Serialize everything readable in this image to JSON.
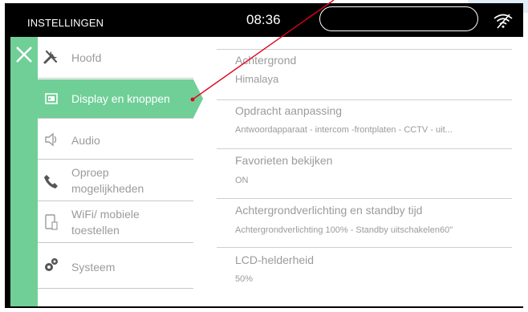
{
  "header": {
    "title": "INSTELLINGEN",
    "time": "08:36"
  },
  "menu": {
    "items": [
      {
        "label": "Hoofd",
        "icon": "wrench-icon"
      },
      {
        "label": "Display en knoppen",
        "icon": "display-icon",
        "active": true
      },
      {
        "label": "Audio",
        "icon": "speaker-icon"
      },
      {
        "label": "Oproep mogelijkheden",
        "icon": "phone-icon"
      },
      {
        "label": "WiFi/ mobiele toestellen",
        "icon": "mobile-device-icon"
      },
      {
        "label": "Systeem",
        "icon": "gears-icon"
      }
    ]
  },
  "settings": [
    {
      "title": "Achtergrond",
      "value": "Himalaya"
    },
    {
      "title": "Opdracht aanpassing",
      "value": "Antwoordapparaat - intercom -frontplaten - CCTV - uit..."
    },
    {
      "title": "Favorieten bekijken",
      "value": "ON"
    },
    {
      "title": "Achtergrondverlichting en standby tijd",
      "value": "Achtergrondverlichting 100% - Standby uitschakelen60\""
    },
    {
      "title": "LCD-helderheid",
      "value": "50%"
    }
  ],
  "colors": {
    "accent_green": "#6fcf97",
    "frame": "#000000",
    "annotation": "#e0001b"
  }
}
